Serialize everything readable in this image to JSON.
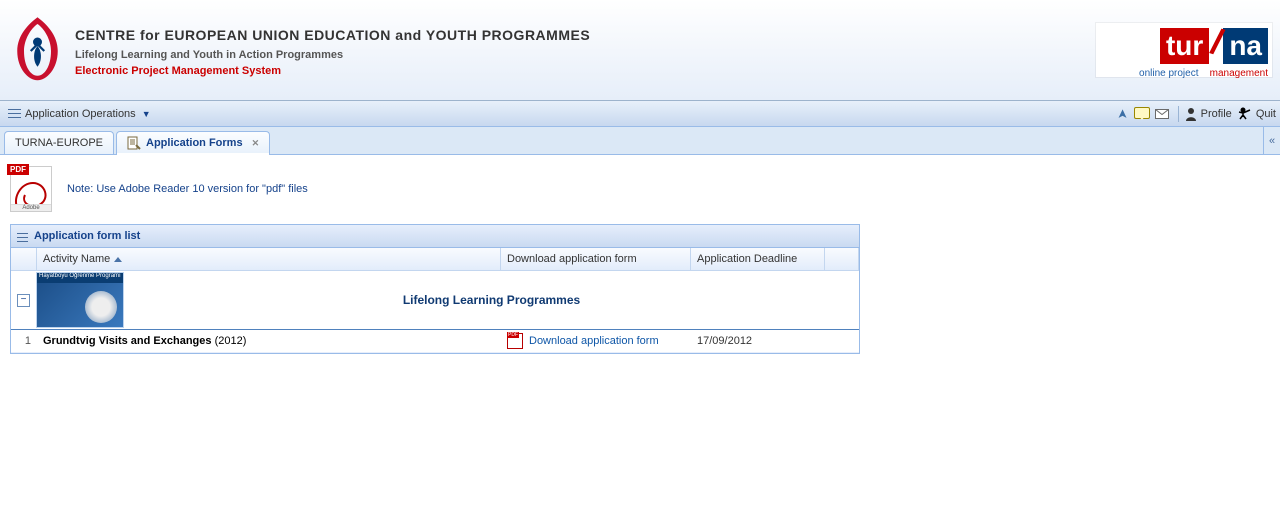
{
  "header": {
    "title": "CENTRE for EUROPEAN UNION EDUCATION and YOUTH PROGRAMMES",
    "subtitle": "Lifelong Learning and Youth in Action Programmes",
    "tagline": "Electronic Project Management System",
    "brand": {
      "part1": "tur",
      "part2": "na",
      "sub_blue": "online project",
      "sub_red": "management"
    }
  },
  "toolbar": {
    "menu_label": "Application Operations",
    "profile_label": "Profile",
    "quit_label": "Quit"
  },
  "tabs": {
    "inactive": "TURNA-EUROPE",
    "active": "Application Forms"
  },
  "note": "Note: Use Adobe Reader 10 version for \"pdf\" files",
  "pdf_icon": {
    "tag": "PDF",
    "vendor": "Adobe"
  },
  "panel": {
    "title": "Application form list",
    "columns": {
      "activity_name": "Activity Name",
      "download": "Download application form",
      "deadline": "Application Deadline"
    },
    "group": {
      "thumb_label": "Hayatboyu Öğrenme Programı",
      "title": "Lifelong Learning Programmes"
    },
    "rows": [
      {
        "idx": "1",
        "activity_name": "Grundtvig Visits and Exchanges",
        "activity_year": "(2012)",
        "download_label": "Download application form",
        "deadline": "17/09/2012"
      }
    ]
  }
}
